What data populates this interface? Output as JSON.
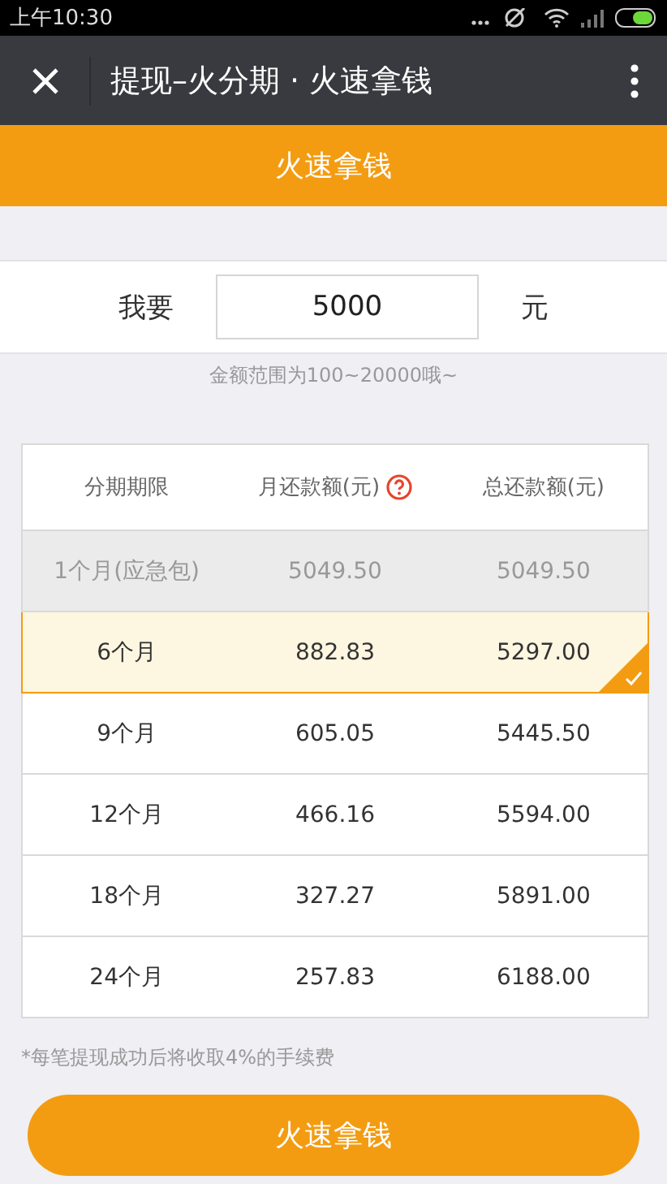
{
  "status_bar": {
    "time": "上午10:30"
  },
  "nav_bar": {
    "title": "提现–火分期 · 火速拿钱"
  },
  "header": {
    "title": "火速拿钱"
  },
  "amount": {
    "label": "我要",
    "value": "5000",
    "unit": "元",
    "hint": "金额范围为100~20000哦~"
  },
  "table": {
    "columns": [
      "分期期限",
      "月还款额(元)",
      "总还款额(元)"
    ],
    "rows": [
      {
        "term": "1个月(应急包)",
        "monthly": "5049.50",
        "total": "5049.50",
        "disabled": true,
        "selected": false
      },
      {
        "term": "6个月",
        "monthly": "882.83",
        "total": "5297.00",
        "disabled": false,
        "selected": true
      },
      {
        "term": "9个月",
        "monthly": "605.05",
        "total": "5445.50",
        "disabled": false,
        "selected": false
      },
      {
        "term": "12个月",
        "monthly": "466.16",
        "total": "5594.00",
        "disabled": false,
        "selected": false
      },
      {
        "term": "18个月",
        "monthly": "327.27",
        "total": "5891.00",
        "disabled": false,
        "selected": false
      },
      {
        "term": "24个月",
        "monthly": "257.83",
        "total": "6188.00",
        "disabled": false,
        "selected": false
      }
    ]
  },
  "note": "*每笔提现成功后将收取4%的手续费",
  "submit_button": {
    "label": "火速拿钱"
  }
}
